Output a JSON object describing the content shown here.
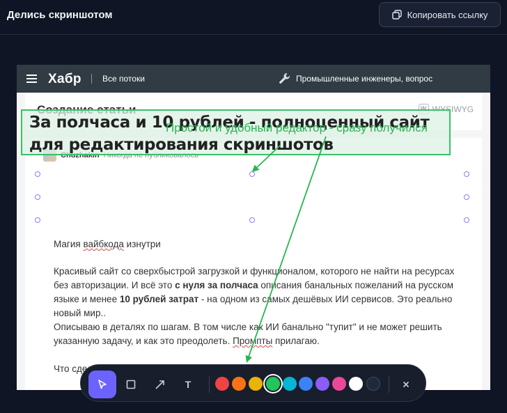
{
  "app": {
    "title": "Делись скриншотом",
    "copy_button_label": "Копировать ссылку",
    "copy_icon": "copy-icon"
  },
  "habr": {
    "logo": "Хабр",
    "streams_link": "Все потоки",
    "hub_label": "Промышленные инженеры, вопрос",
    "menu_icon": "hamburger-icon",
    "hub_icon": "wrench-icon"
  },
  "editor": {
    "page_title": "Создание статьи",
    "mode_badge": "W",
    "mode_label": "WYSIWYG",
    "author_name": "Chuzhakin",
    "author_status": "Никогда не публиковалось",
    "article_title": "За полчаса и 10 рублей - полноценный сайт для редактирования скриншотов",
    "p1_a": "Магия ",
    "p1_b": "вайбкода",
    "p1_c": " изнутри",
    "p2_a": "Красивый сайт со сверхбыстрой загрузкой и функционалом, которого не найти на ресурсах без авторизации. И всё это ",
    "p2_b": "с нуля за полчаса",
    "p2_c": " описания банальных пожеланий на русском языке и менее ",
    "p2_d": "10 рублей затрат",
    "p2_e": " - на одном из самых дешёвых ИИ сервисов.  Это реально новый мир..",
    "p3_a": "Описываю в деталях по шагам. В том числе как ИИ банально \"тупит\" и не может решить указанную задачу, и как это преодолеть. ",
    "p3_b": "Промпты",
    "p3_c": " прилагаю.",
    "p4": "Что сделал"
  },
  "annotation": {
    "text": "Простой и удобный редактор - сразу получился",
    "color": "#27b552"
  },
  "toolbar": {
    "tools": [
      {
        "name": "select",
        "icon": "cursor-icon"
      },
      {
        "name": "rectangle",
        "icon": "square-icon"
      },
      {
        "name": "arrow",
        "icon": "arrow-icon"
      },
      {
        "name": "text",
        "label": "T",
        "icon": "text-icon"
      }
    ],
    "active_tool": "select",
    "colors": [
      "#ef4444",
      "#f97316",
      "#eab308",
      "#22c55e",
      "#06b6d4",
      "#3b82f6",
      "#8b5cf6",
      "#ec4899",
      "#ffffff",
      "#1e293b"
    ],
    "selected_color": "#22c55e",
    "close_icon": "close-icon",
    "accent": "#6c63ff"
  }
}
